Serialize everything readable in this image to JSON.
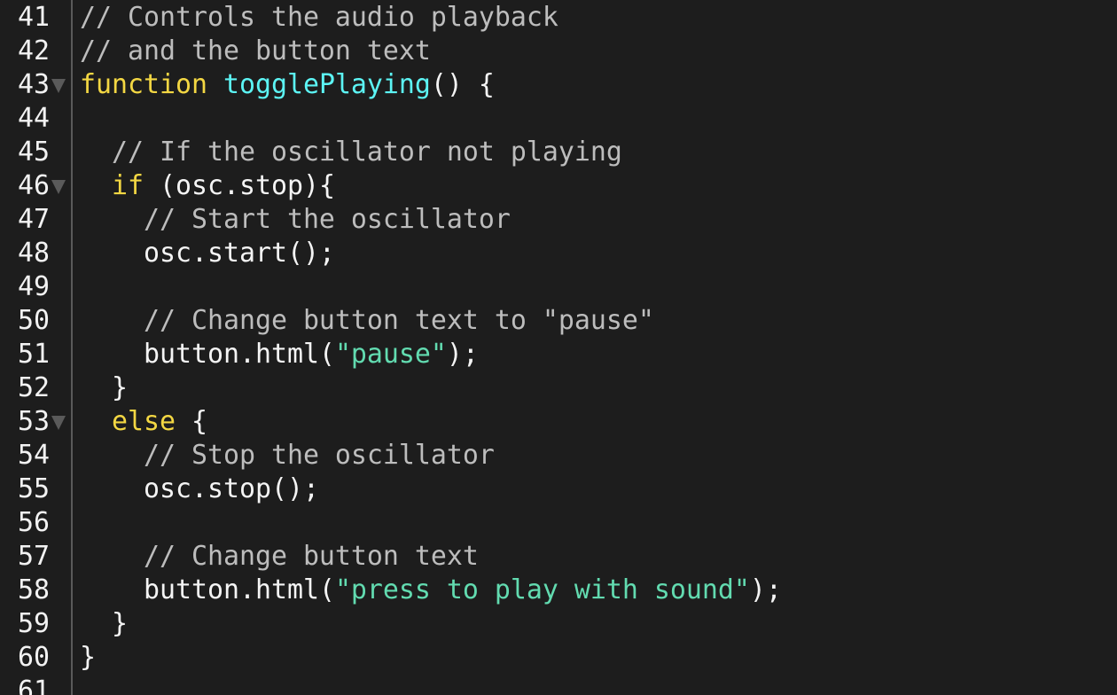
{
  "editor": {
    "colors": {
      "background": "#1d1d1d",
      "comment": "#bdbdbd",
      "keyword": "#f3d743",
      "function": "#5cf4f4",
      "string": "#62dbb0",
      "plain": "#f4f4f4"
    },
    "lines": [
      {
        "num": "41",
        "fold": false,
        "tokens": [
          {
            "t": "comment",
            "v": "// Controls the audio playback"
          }
        ]
      },
      {
        "num": "42",
        "fold": false,
        "tokens": [
          {
            "t": "comment",
            "v": "// and the button text"
          }
        ]
      },
      {
        "num": "43",
        "fold": true,
        "tokens": [
          {
            "t": "keyword",
            "v": "function"
          },
          {
            "t": "plain",
            "v": " "
          },
          {
            "t": "func",
            "v": "togglePlaying"
          },
          {
            "t": "plain",
            "v": "() {"
          }
        ]
      },
      {
        "num": "44",
        "fold": false,
        "tokens": []
      },
      {
        "num": "45",
        "fold": false,
        "tokens": [
          {
            "t": "plain",
            "v": "  "
          },
          {
            "t": "comment",
            "v": "// If the oscillator not playing"
          }
        ]
      },
      {
        "num": "46",
        "fold": true,
        "tokens": [
          {
            "t": "plain",
            "v": "  "
          },
          {
            "t": "keyword",
            "v": "if"
          },
          {
            "t": "plain",
            "v": " (osc.stop){"
          }
        ]
      },
      {
        "num": "47",
        "fold": false,
        "tokens": [
          {
            "t": "plain",
            "v": "    "
          },
          {
            "t": "comment",
            "v": "// Start the oscillator"
          }
        ]
      },
      {
        "num": "48",
        "fold": false,
        "tokens": [
          {
            "t": "plain",
            "v": "    osc.start();"
          }
        ]
      },
      {
        "num": "49",
        "fold": false,
        "tokens": []
      },
      {
        "num": "50",
        "fold": false,
        "tokens": [
          {
            "t": "plain",
            "v": "    "
          },
          {
            "t": "comment",
            "v": "// Change button text to \"pause\""
          }
        ]
      },
      {
        "num": "51",
        "fold": false,
        "tokens": [
          {
            "t": "plain",
            "v": "    button.html("
          },
          {
            "t": "string",
            "v": "\"pause\""
          },
          {
            "t": "plain",
            "v": ");"
          }
        ]
      },
      {
        "num": "52",
        "fold": false,
        "tokens": [
          {
            "t": "plain",
            "v": "  }"
          }
        ]
      },
      {
        "num": "53",
        "fold": true,
        "tokens": [
          {
            "t": "plain",
            "v": "  "
          },
          {
            "t": "keyword",
            "v": "else"
          },
          {
            "t": "plain",
            "v": " {"
          }
        ]
      },
      {
        "num": "54",
        "fold": false,
        "tokens": [
          {
            "t": "plain",
            "v": "    "
          },
          {
            "t": "comment",
            "v": "// Stop the oscillator"
          }
        ]
      },
      {
        "num": "55",
        "fold": false,
        "tokens": [
          {
            "t": "plain",
            "v": "    osc.stop();"
          }
        ]
      },
      {
        "num": "56",
        "fold": false,
        "tokens": []
      },
      {
        "num": "57",
        "fold": false,
        "tokens": [
          {
            "t": "plain",
            "v": "    "
          },
          {
            "t": "comment",
            "v": "// Change button text"
          }
        ]
      },
      {
        "num": "58",
        "fold": false,
        "tokens": [
          {
            "t": "plain",
            "v": "    button.html("
          },
          {
            "t": "string",
            "v": "\"press to play with sound\""
          },
          {
            "t": "plain",
            "v": ");"
          }
        ]
      },
      {
        "num": "59",
        "fold": false,
        "tokens": [
          {
            "t": "plain",
            "v": "  }"
          }
        ]
      },
      {
        "num": "60",
        "fold": false,
        "tokens": [
          {
            "t": "plain",
            "v": "}"
          }
        ]
      },
      {
        "num": "61",
        "fold": false,
        "tokens": []
      }
    ]
  }
}
